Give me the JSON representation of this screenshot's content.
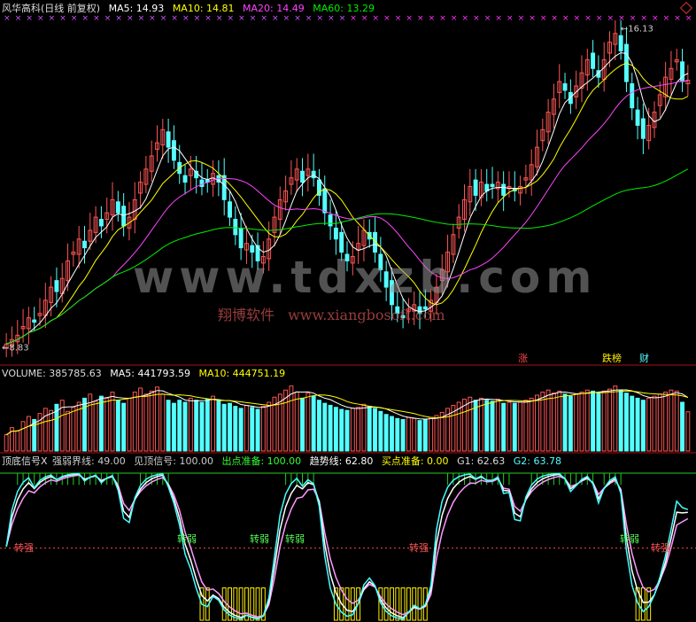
{
  "price_header": {
    "title": "风华高科(日线 前复权)",
    "ma5": "MA5: 14.93",
    "ma10": "MA10: 14.81",
    "ma20": "MA20: 14.49",
    "ma60": "MA60: 13.29"
  },
  "volume_header": {
    "volume": "VOLUME: 385785.63",
    "ma5": "MA5: 441793.59",
    "ma10": "MA10: 444751.19"
  },
  "indicator_header": {
    "name": "顶底信号X",
    "strong_weak_line": "强弱界线: 49.00",
    "top_signal": "见顶信号: 100.00",
    "sell_prep": "出点准备: 100.00",
    "trend_line": "趋势线: 62.80",
    "buy_prep": "买点准备: 0.00",
    "g1": "G1: 62.63",
    "g2": "G2: 63.78"
  },
  "watermark": {
    "url": "www.tdxzb.com",
    "company": "翔博软件",
    "company_url": "www.xiangbosoft.com"
  },
  "colors": {
    "up": "#ff5555",
    "down": "#54ffff",
    "ma5": "#ffffff",
    "ma10": "#ffff00",
    "ma20": "#ff44ff",
    "ma60": "#00ee00",
    "divider": "#aa1111"
  },
  "chart_data": [
    {
      "type": "candlestick",
      "title": "风华高科(日线 前复权)",
      "ylim": [
        8.5,
        16.4
      ],
      "annotations": [
        {
          "label": "16.13",
          "value": 16.13,
          "position": "high"
        },
        {
          "label": "8.83",
          "value": 8.83,
          "position": "low"
        }
      ],
      "markers": [
        "涨",
        "跌榜",
        "财"
      ],
      "series": [
        {
          "name": "MA5",
          "last": 14.93
        },
        {
          "name": "MA10",
          "last": 14.81
        },
        {
          "name": "MA20",
          "last": 14.49
        },
        {
          "name": "MA60",
          "last": 13.29
        }
      ],
      "close": [
        8.9,
        9.0,
        9.1,
        9.3,
        9.5,
        9.4,
        9.6,
        9.9,
        10.2,
        10.1,
        10.4,
        10.8,
        11.0,
        11.3,
        11.1,
        11.5,
        11.8,
        11.6,
        11.9,
        12.2,
        11.9,
        11.6,
        11.8,
        12.2,
        12.6,
        12.9,
        13.2,
        13.5,
        13.8,
        13.4,
        13.1,
        12.8,
        12.6,
        12.9,
        12.7,
        12.5,
        12.6,
        12.8,
        12.6,
        12.2,
        11.8,
        11.4,
        11.1,
        11.2,
        11.0,
        10.8,
        10.9,
        11.3,
        11.8,
        12.2,
        12.4,
        12.7,
        12.9,
        12.6,
        12.9,
        12.7,
        12.3,
        11.9,
        11.6,
        11.3,
        11.0,
        10.8,
        10.9,
        11.2,
        11.5,
        11.3,
        11.0,
        10.6,
        10.2,
        9.8,
        9.6,
        9.5,
        9.7,
        9.8,
        9.6,
        9.7,
        9.9,
        10.2,
        10.6,
        11.0,
        11.4,
        11.8,
        12.2,
        12.5,
        12.3,
        12.6,
        12.4,
        12.5,
        12.6,
        12.3,
        12.5,
        12.4,
        12.5,
        12.7,
        13.0,
        13.4,
        13.8,
        14.2,
        14.5,
        14.9,
        14.7,
        14.4,
        14.8,
        15.1,
        15.4,
        15.2,
        15.0,
        15.4,
        15.8,
        16.0,
        15.6,
        14.9,
        14.3,
        13.9,
        13.6,
        13.9,
        14.2,
        14.6,
        15.0,
        15.2,
        15.4,
        14.9,
        14.93
      ],
      "volume": [
        160,
        230,
        200,
        290,
        340,
        310,
        370,
        420,
        400,
        460,
        500,
        390,
        430,
        480,
        520,
        560,
        490,
        540,
        520,
        580,
        500,
        470,
        520,
        580,
        620,
        560,
        590,
        630,
        560,
        500,
        470,
        500,
        480,
        520,
        500,
        480,
        510,
        540,
        500,
        460,
        470,
        440,
        420,
        450,
        430,
        410,
        440,
        480,
        530,
        560,
        600,
        640,
        580,
        520,
        570,
        540,
        500,
        470,
        450,
        430,
        410,
        400,
        420,
        430,
        460,
        440,
        420,
        390,
        360,
        340,
        320,
        310,
        330,
        320,
        300,
        310,
        330,
        350,
        380,
        420,
        450,
        480,
        510,
        530,
        500,
        520,
        500,
        490,
        510,
        470,
        480,
        470,
        480,
        500,
        520,
        550,
        580,
        600,
        570,
        590,
        560,
        540,
        560,
        580,
        600,
        590,
        570,
        590,
        610,
        640,
        600,
        570,
        540,
        520,
        500,
        520,
        540,
        560,
        580,
        600,
        590,
        480,
        385.79
      ]
    },
    {
      "type": "line",
      "title": "顶底信号X",
      "ylim": [
        0,
        100
      ],
      "labels": [
        "转强",
        "转弱",
        "转弱",
        "转强",
        "转弱",
        "转强",
        "转弱"
      ],
      "series": [
        {
          "name": "趋势线",
          "last": 62.8
        },
        {
          "name": "G1",
          "last": 62.63
        },
        {
          "name": "G2",
          "last": 63.78
        }
      ]
    }
  ]
}
